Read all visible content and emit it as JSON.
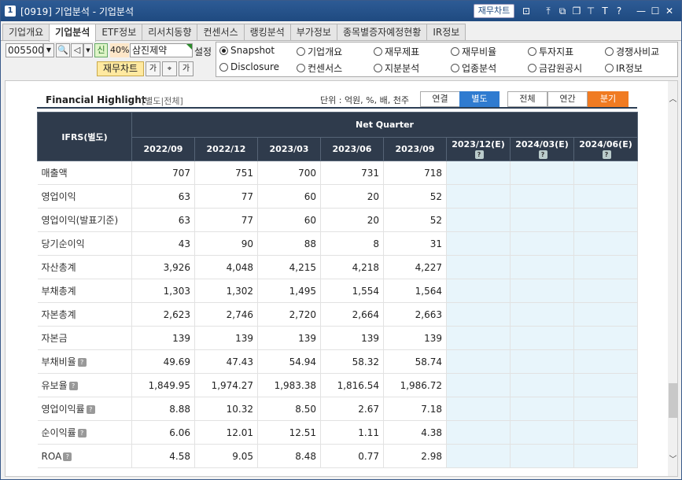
{
  "window": {
    "number_badge": "1",
    "title": "[0919] 기업분석 - 기업분석",
    "chart_button": "재무차트",
    "icons": [
      "chart-icon",
      "upload-icon",
      "window-icon",
      "restore-icon",
      "pin-icon",
      "font-icon",
      "help-icon",
      "minimize-icon",
      "maximize-icon",
      "close-icon"
    ]
  },
  "tabs": [
    {
      "label": "기업개요",
      "active": false
    },
    {
      "label": "기업분석",
      "active": true
    },
    {
      "label": "ETF정보",
      "active": false
    },
    {
      "label": "리서치동향",
      "active": false
    },
    {
      "label": "컨센서스",
      "active": false
    },
    {
      "label": "랭킹분석",
      "active": false
    },
    {
      "label": "부가정보",
      "active": false
    },
    {
      "label": "종목별증자예정현황",
      "active": false
    },
    {
      "label": "IR정보",
      "active": false
    }
  ],
  "toolbar": {
    "stock_code": "005500",
    "new_badge": "신",
    "ratio": "40%",
    "stock_name": "삼진제약",
    "settings_label": "설정",
    "chart_button": "재무차트",
    "small_btn_1": "가",
    "small_btn_2": "⌖",
    "small_btn_3": "가"
  },
  "radios": [
    {
      "label": "Snapshot",
      "checked": true
    },
    {
      "label": "기업개요",
      "checked": false
    },
    {
      "label": "재무제표",
      "checked": false
    },
    {
      "label": "재무비율",
      "checked": false
    },
    {
      "label": "투자지표",
      "checked": false
    },
    {
      "label": "경쟁사비교",
      "checked": false
    },
    {
      "label": "Disclosure",
      "checked": false
    },
    {
      "label": "컨센서스",
      "checked": false
    },
    {
      "label": "지분분석",
      "checked": false
    },
    {
      "label": "업종분석",
      "checked": false
    },
    {
      "label": "금감원공시",
      "checked": false
    },
    {
      "label": "IR정보",
      "checked": false
    }
  ],
  "highlight": {
    "title": "Financial Highlight",
    "subtitle": "[별도|전체]",
    "unit_label": "단위 : 억원, %, 배, 천주",
    "basis_buttons": [
      {
        "label": "연결",
        "active": false
      },
      {
        "label": "별도",
        "active": true
      }
    ],
    "period_buttons": [
      {
        "label": "전체",
        "active": false
      },
      {
        "label": "연간",
        "active": false
      },
      {
        "label": "분기",
        "active": true
      }
    ]
  },
  "table": {
    "corner_header": "IFRS(별도)",
    "group_header": "Net Quarter",
    "periods": [
      "2022/09",
      "2022/12",
      "2023/03",
      "2023/06",
      "2023/09",
      "2023/12(E)",
      "2024/03(E)",
      "2024/06(E)"
    ],
    "rows": [
      {
        "label": "매출액",
        "help": false,
        "values": [
          "707",
          "751",
          "700",
          "731",
          "718",
          "",
          "",
          ""
        ]
      },
      {
        "label": "영업이익",
        "help": false,
        "values": [
          "63",
          "77",
          "60",
          "20",
          "52",
          "",
          "",
          ""
        ]
      },
      {
        "label": "영업이익(발표기준)",
        "help": false,
        "values": [
          "63",
          "77",
          "60",
          "20",
          "52",
          "",
          "",
          ""
        ]
      },
      {
        "label": "당기순이익",
        "help": false,
        "values": [
          "43",
          "90",
          "88",
          "8",
          "31",
          "",
          "",
          ""
        ]
      },
      {
        "label": "자산총계",
        "help": false,
        "values": [
          "3,926",
          "4,048",
          "4,215",
          "4,218",
          "4,227",
          "",
          "",
          ""
        ]
      },
      {
        "label": "부채총계",
        "help": false,
        "values": [
          "1,303",
          "1,302",
          "1,495",
          "1,554",
          "1,564",
          "",
          "",
          ""
        ]
      },
      {
        "label": "자본총계",
        "help": false,
        "values": [
          "2,623",
          "2,746",
          "2,720",
          "2,664",
          "2,663",
          "",
          "",
          ""
        ]
      },
      {
        "label": "자본금",
        "help": false,
        "values": [
          "139",
          "139",
          "139",
          "139",
          "139",
          "",
          "",
          ""
        ]
      },
      {
        "label": "부채비율",
        "help": true,
        "values": [
          "49.69",
          "47.43",
          "54.94",
          "58.32",
          "58.74",
          "",
          "",
          ""
        ]
      },
      {
        "label": "유보율",
        "help": true,
        "values": [
          "1,849.95",
          "1,974.27",
          "1,983.38",
          "1,816.54",
          "1,986.72",
          "",
          "",
          ""
        ]
      },
      {
        "label": "영업이익률",
        "help": true,
        "values": [
          "8.88",
          "10.32",
          "8.50",
          "2.67",
          "7.18",
          "",
          "",
          ""
        ]
      },
      {
        "label": "순이익률",
        "help": true,
        "values": [
          "6.06",
          "12.01",
          "12.51",
          "1.11",
          "4.38",
          "",
          "",
          ""
        ]
      },
      {
        "label": "ROA",
        "help": true,
        "values": [
          "4.58",
          "9.05",
          "8.48",
          "0.77",
          "2.98",
          "",
          "",
          ""
        ]
      }
    ]
  }
}
